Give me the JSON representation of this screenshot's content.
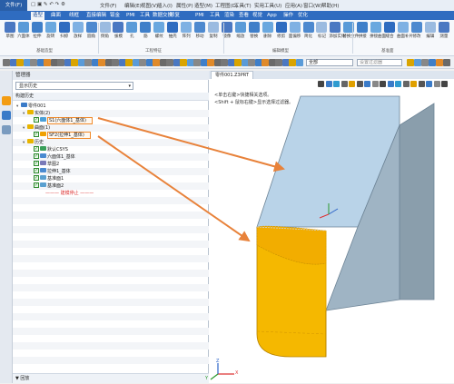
{
  "menu": {
    "file": "文件(F)",
    "items": [
      "文件(F)",
      "编辑(E)",
      "视图(V)",
      "插入(I)",
      "属性(P)",
      "造型(M)",
      "工程图(D)",
      "工具(T)",
      "实用工具(U)",
      "应用(A)",
      "窗口(W)",
      "帮助(H)"
    ]
  },
  "ribbon_tabs": [
    "文件",
    "造型",
    "曲面",
    "线框",
    "直接编辑",
    "钣金",
    "PMI",
    "工具",
    "数据交换",
    "修复",
    "PMI",
    "工具",
    "渲染",
    "查看",
    "视觉",
    "App",
    "操作",
    "优化"
  ],
  "ribbon_active": "造型",
  "ribbon": {
    "buttons": [
      "草图",
      "六面体",
      "拉伸",
      "旋转",
      "扫掠",
      "放样",
      "圆角",
      "倒角",
      "拔模",
      "孔",
      "筋",
      "螺纹",
      "抽壳",
      "阵列",
      "移动",
      "复制",
      "镜像",
      "缩放",
      "替换",
      "删除",
      "修剪",
      "面偏移",
      "简化",
      "标记",
      "添加实体",
      "替换文件",
      "拼接",
      "拼接曲面",
      "缝合",
      "曲面补片",
      "修改",
      "编辑",
      "测量"
    ],
    "groups": [
      "基础造型",
      "工程特征",
      "编辑模型",
      "基准面"
    ]
  },
  "toolbar2": {
    "filter_all": "全部",
    "filter_placeholder": "设置过滤器"
  },
  "panel": {
    "title": "管理器",
    "combo": "显示历史",
    "tree_header": "构建历史",
    "footer": "▼ 回放"
  },
  "tree": [
    {
      "label": "零件001",
      "indent": 0,
      "icon": "part-icon"
    },
    {
      "label": "实体(2)",
      "indent": 1,
      "icon": "folder-icon"
    },
    {
      "label": "S1(六面体1_基体)",
      "indent": 2,
      "icon": "solid-icon",
      "checked": true,
      "highlight": true
    },
    {
      "label": "曲面(1)",
      "indent": 1,
      "icon": "folder-icon"
    },
    {
      "label": "SF2(拉伸1_基体)",
      "indent": 2,
      "icon": "surface-icon",
      "checked": true,
      "highlight": true
    },
    {
      "label": "历史",
      "indent": 1,
      "icon": "folder-icon"
    },
    {
      "label": "默认CSYS",
      "indent": 2,
      "icon": "csys-icon",
      "checked": true
    },
    {
      "label": "六面体1_基体",
      "indent": 2,
      "icon": "feature-icon",
      "checked": true
    },
    {
      "label": "草图2",
      "indent": 2,
      "icon": "sketch-icon",
      "checked": true
    },
    {
      "label": "拉伸1_基体",
      "indent": 2,
      "icon": "feature-icon",
      "checked": true
    },
    {
      "label": "基准面1",
      "indent": 2,
      "icon": "plane-icon",
      "checked": true
    },
    {
      "label": "基准面2",
      "indent": 2,
      "icon": "plane-icon",
      "checked": true
    },
    {
      "label": "——— 建模停止 ———",
      "indent": 2,
      "icon": "stop-icon",
      "stop": true
    }
  ],
  "viewport": {
    "tab": "零件001.Z3PRT",
    "hint1": "<单击右键>快捷相关选项。",
    "hint2": "<Shift + 鼠标右键>显示选择过滤器。",
    "axis_labels": [
      "X",
      "Y",
      "Z"
    ]
  },
  "colors": {
    "accent": "#2f6cc0",
    "arrow": "#e8823a",
    "box_top": "#b7d3ea",
    "box_side": "#8fa2b0",
    "cylinder": "#f5b800",
    "highlight": "#f08a2a"
  }
}
